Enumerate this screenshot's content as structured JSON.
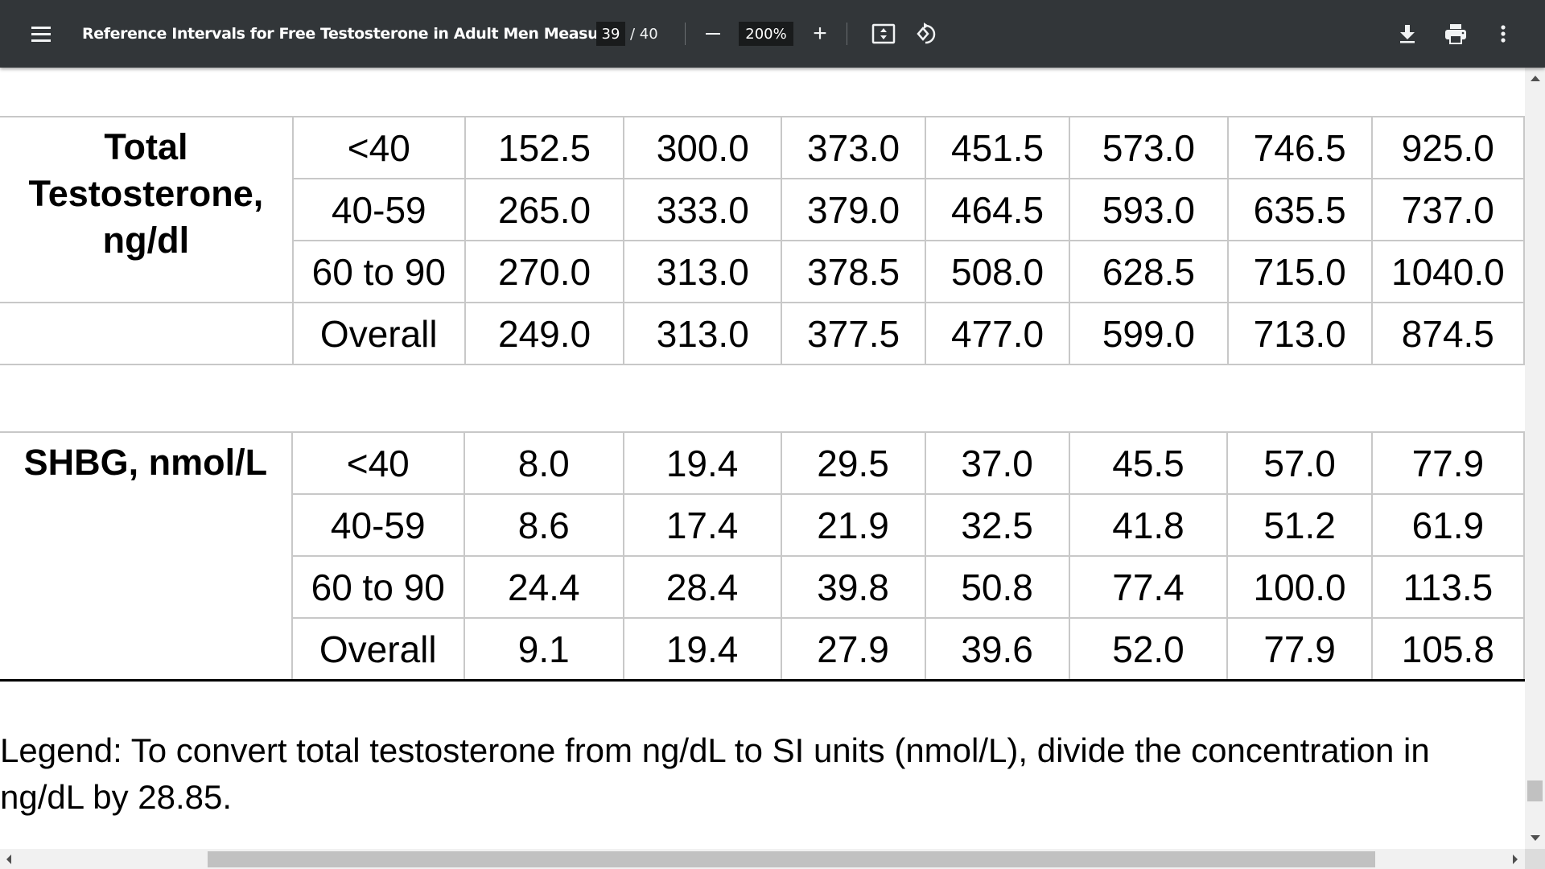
{
  "toolbar": {
    "title": "Reference Intervals for Free Testosterone in Adult Men Measur...",
    "page_current": "39",
    "page_total": "/ 40",
    "zoom_level": "200%",
    "zoom_out_icon": "minus-icon",
    "zoom_in_label": "+",
    "icons": [
      "menu-icon",
      "fit-page-icon",
      "rotate-icon",
      "download-icon",
      "print-icon",
      "more-vert-icon"
    ]
  },
  "tables": [
    {
      "label_lines": [
        "Total",
        "Testosterone,",
        "ng/dl"
      ],
      "rows": [
        {
          "group": "<40",
          "values": [
            "152.5",
            "300.0",
            "373.0",
            "451.5",
            "573.0",
            "746.5",
            "925.0"
          ]
        },
        {
          "group": "40-59",
          "values": [
            "265.0",
            "333.0",
            "379.0",
            "464.5",
            "593.0",
            "635.5",
            "737.0"
          ]
        },
        {
          "group": "60 to 90",
          "values": [
            "270.0",
            "313.0",
            "378.5",
            "508.0",
            "628.5",
            "715.0",
            "1040.0"
          ]
        },
        {
          "group": "Overall",
          "values": [
            "249.0",
            "313.0",
            "377.5",
            "477.0",
            "599.0",
            "713.0",
            "874.5"
          ]
        }
      ]
    },
    {
      "label_lines": [
        "SHBG, nmol/L"
      ],
      "rows": [
        {
          "group": "<40",
          "values": [
            "8.0",
            "19.4",
            "29.5",
            "37.0",
            "45.5",
            "57.0",
            "77.9"
          ]
        },
        {
          "group": "40-59",
          "values": [
            "8.6",
            "17.4",
            "21.9",
            "32.5",
            "41.8",
            "51.2",
            "61.9"
          ]
        },
        {
          "group": "60 to 90",
          "values": [
            "24.4",
            "28.4",
            "39.8",
            "50.8",
            "77.4",
            "100.0",
            "113.5"
          ]
        },
        {
          "group": "Overall",
          "values": [
            "9.1",
            "19.4",
            "27.9",
            "39.6",
            "52.0",
            "77.9",
            "105.8"
          ]
        }
      ]
    }
  ],
  "legend": {
    "line1": "Legend: To convert total testosterone from ng/dL to SI units (nmol/L), divide the concentration in",
    "line2": "ng/dL by 28.85."
  },
  "colors": {
    "toolbar_bg": "#323639",
    "grid_border": "#c8c8c8",
    "scrollbar_thumb": "#c1c1c1"
  }
}
